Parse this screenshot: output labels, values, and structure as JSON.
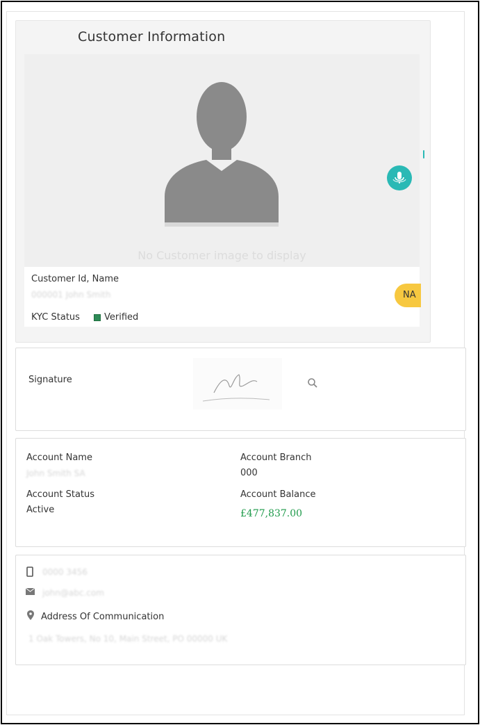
{
  "customer_card": {
    "title": "Customer Information",
    "no_image_text": "No Customer image to display",
    "customer_id_label": "Customer Id, Name",
    "customer_id_value": "000001 John Smith",
    "kyc_label": "KYC Status",
    "kyc_value": "Verified",
    "badge": "NA",
    "mic_icon": "microphone-icon"
  },
  "signature_card": {
    "label": "Signature",
    "zoom_icon": "search-icon"
  },
  "account_card": {
    "name_label": "Account Name",
    "name_value": "John Smith SA",
    "branch_label": "Account Branch",
    "branch_value": "000",
    "status_label": "Account Status",
    "status_value": "Active",
    "balance_label": "Account Balance",
    "balance_value": "£477,837.00",
    "balance_color": "#1e9a4a"
  },
  "contact_card": {
    "phone_value": "0000 3456",
    "email_value": "john@abc.com",
    "address_label": "Address Of Communication",
    "address_value": "1 Oak Towers, No 10, Main Street, PO 00000 UK",
    "phone_icon": "mobile-icon",
    "email_icon": "envelope-icon",
    "address_icon": "map-pin-icon"
  },
  "colors": {
    "accent": "#2ab9b5",
    "badge": "#f7c840",
    "verified": "#2e8b57"
  }
}
